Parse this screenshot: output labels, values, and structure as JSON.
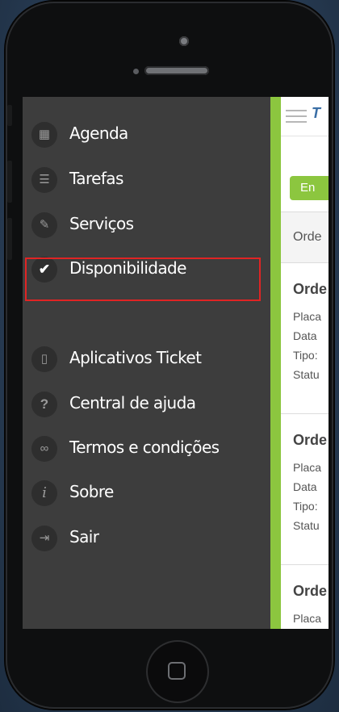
{
  "menu": {
    "items": [
      {
        "label": "Agenda",
        "icon": "calendar-icon",
        "glyph": "▦"
      },
      {
        "label": "Tarefas",
        "icon": "checklist-icon",
        "glyph": "☰"
      },
      {
        "label": "Serviços",
        "icon": "wrench-icon",
        "glyph": "✎"
      },
      {
        "label": "Disponibilidade",
        "icon": "check-icon",
        "glyph": "✔"
      },
      {
        "label": "Aplicativos Ticket",
        "icon": "phone-icon",
        "glyph": "▯"
      },
      {
        "label": "Central de ajuda",
        "icon": "question-icon",
        "glyph": "?"
      },
      {
        "label": "Termos e condições",
        "icon": "glasses-icon",
        "glyph": "∞"
      },
      {
        "label": "Sobre",
        "icon": "info-icon",
        "glyph": "i"
      },
      {
        "label": "Sair",
        "icon": "exit-icon",
        "glyph": "⇥"
      }
    ]
  },
  "content": {
    "logo": "T",
    "button_label": "En",
    "header_label": "Orde",
    "cards": [
      {
        "title": "Orde",
        "fields": [
          "Placa",
          "Data",
          "Tipo:",
          "Statu"
        ]
      },
      {
        "title": "Orde",
        "fields": [
          "Placa",
          "Data",
          "Tipo:",
          "Statu"
        ]
      },
      {
        "title": "Orde",
        "fields": [
          "Placa"
        ]
      }
    ]
  },
  "colors": {
    "accent": "#8cc63f",
    "drawer_bg": "#3d3d3d",
    "highlight": "#e02424"
  }
}
